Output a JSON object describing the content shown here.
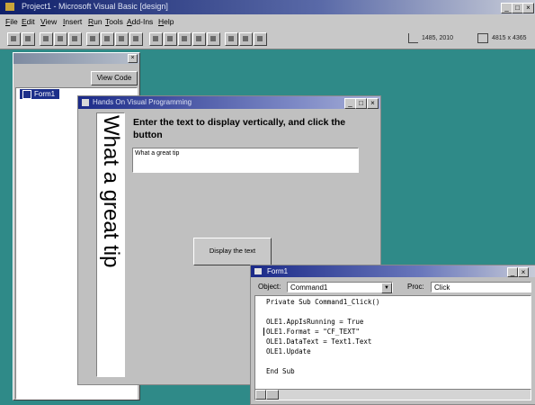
{
  "ide": {
    "title": "Project1 - Microsoft Visual Basic [design]",
    "caption_buttons": [
      "_",
      "□",
      "×"
    ]
  },
  "menu": [
    "File",
    "Edit",
    "View",
    "Insert",
    "Run",
    "Tools",
    "Add-Ins",
    "Help"
  ],
  "toolbar": {
    "position_readout": "1485, 2010",
    "size_readout": "4815 x 4365"
  },
  "project": {
    "view_code_label": "View Code",
    "item": "Form1"
  },
  "form": {
    "title": "Hands On Visual Programming",
    "vertical_text": "What a great tip",
    "prompt": "Enter the text to display vertically, and click the button",
    "textbox_value": "What a great tip",
    "button_label": "Display the text"
  },
  "code": {
    "title": "Form1",
    "object_label": "Object:",
    "object_value": "Command1",
    "proc_label": "Proc:",
    "proc_value": "Click",
    "lines": [
      "Private Sub Command1_Click()",
      "",
      "OLE1.AppIsRunning = True",
      "OLE1.Format = \"CF_TEXT\"",
      "OLE1.DataText = Text1.Text",
      "OLE1.Update",
      "",
      "End Sub"
    ]
  },
  "colors": {
    "desktop": "#2f8a88",
    "title_active": "#1b2a88",
    "face": "#c0c0c0"
  }
}
